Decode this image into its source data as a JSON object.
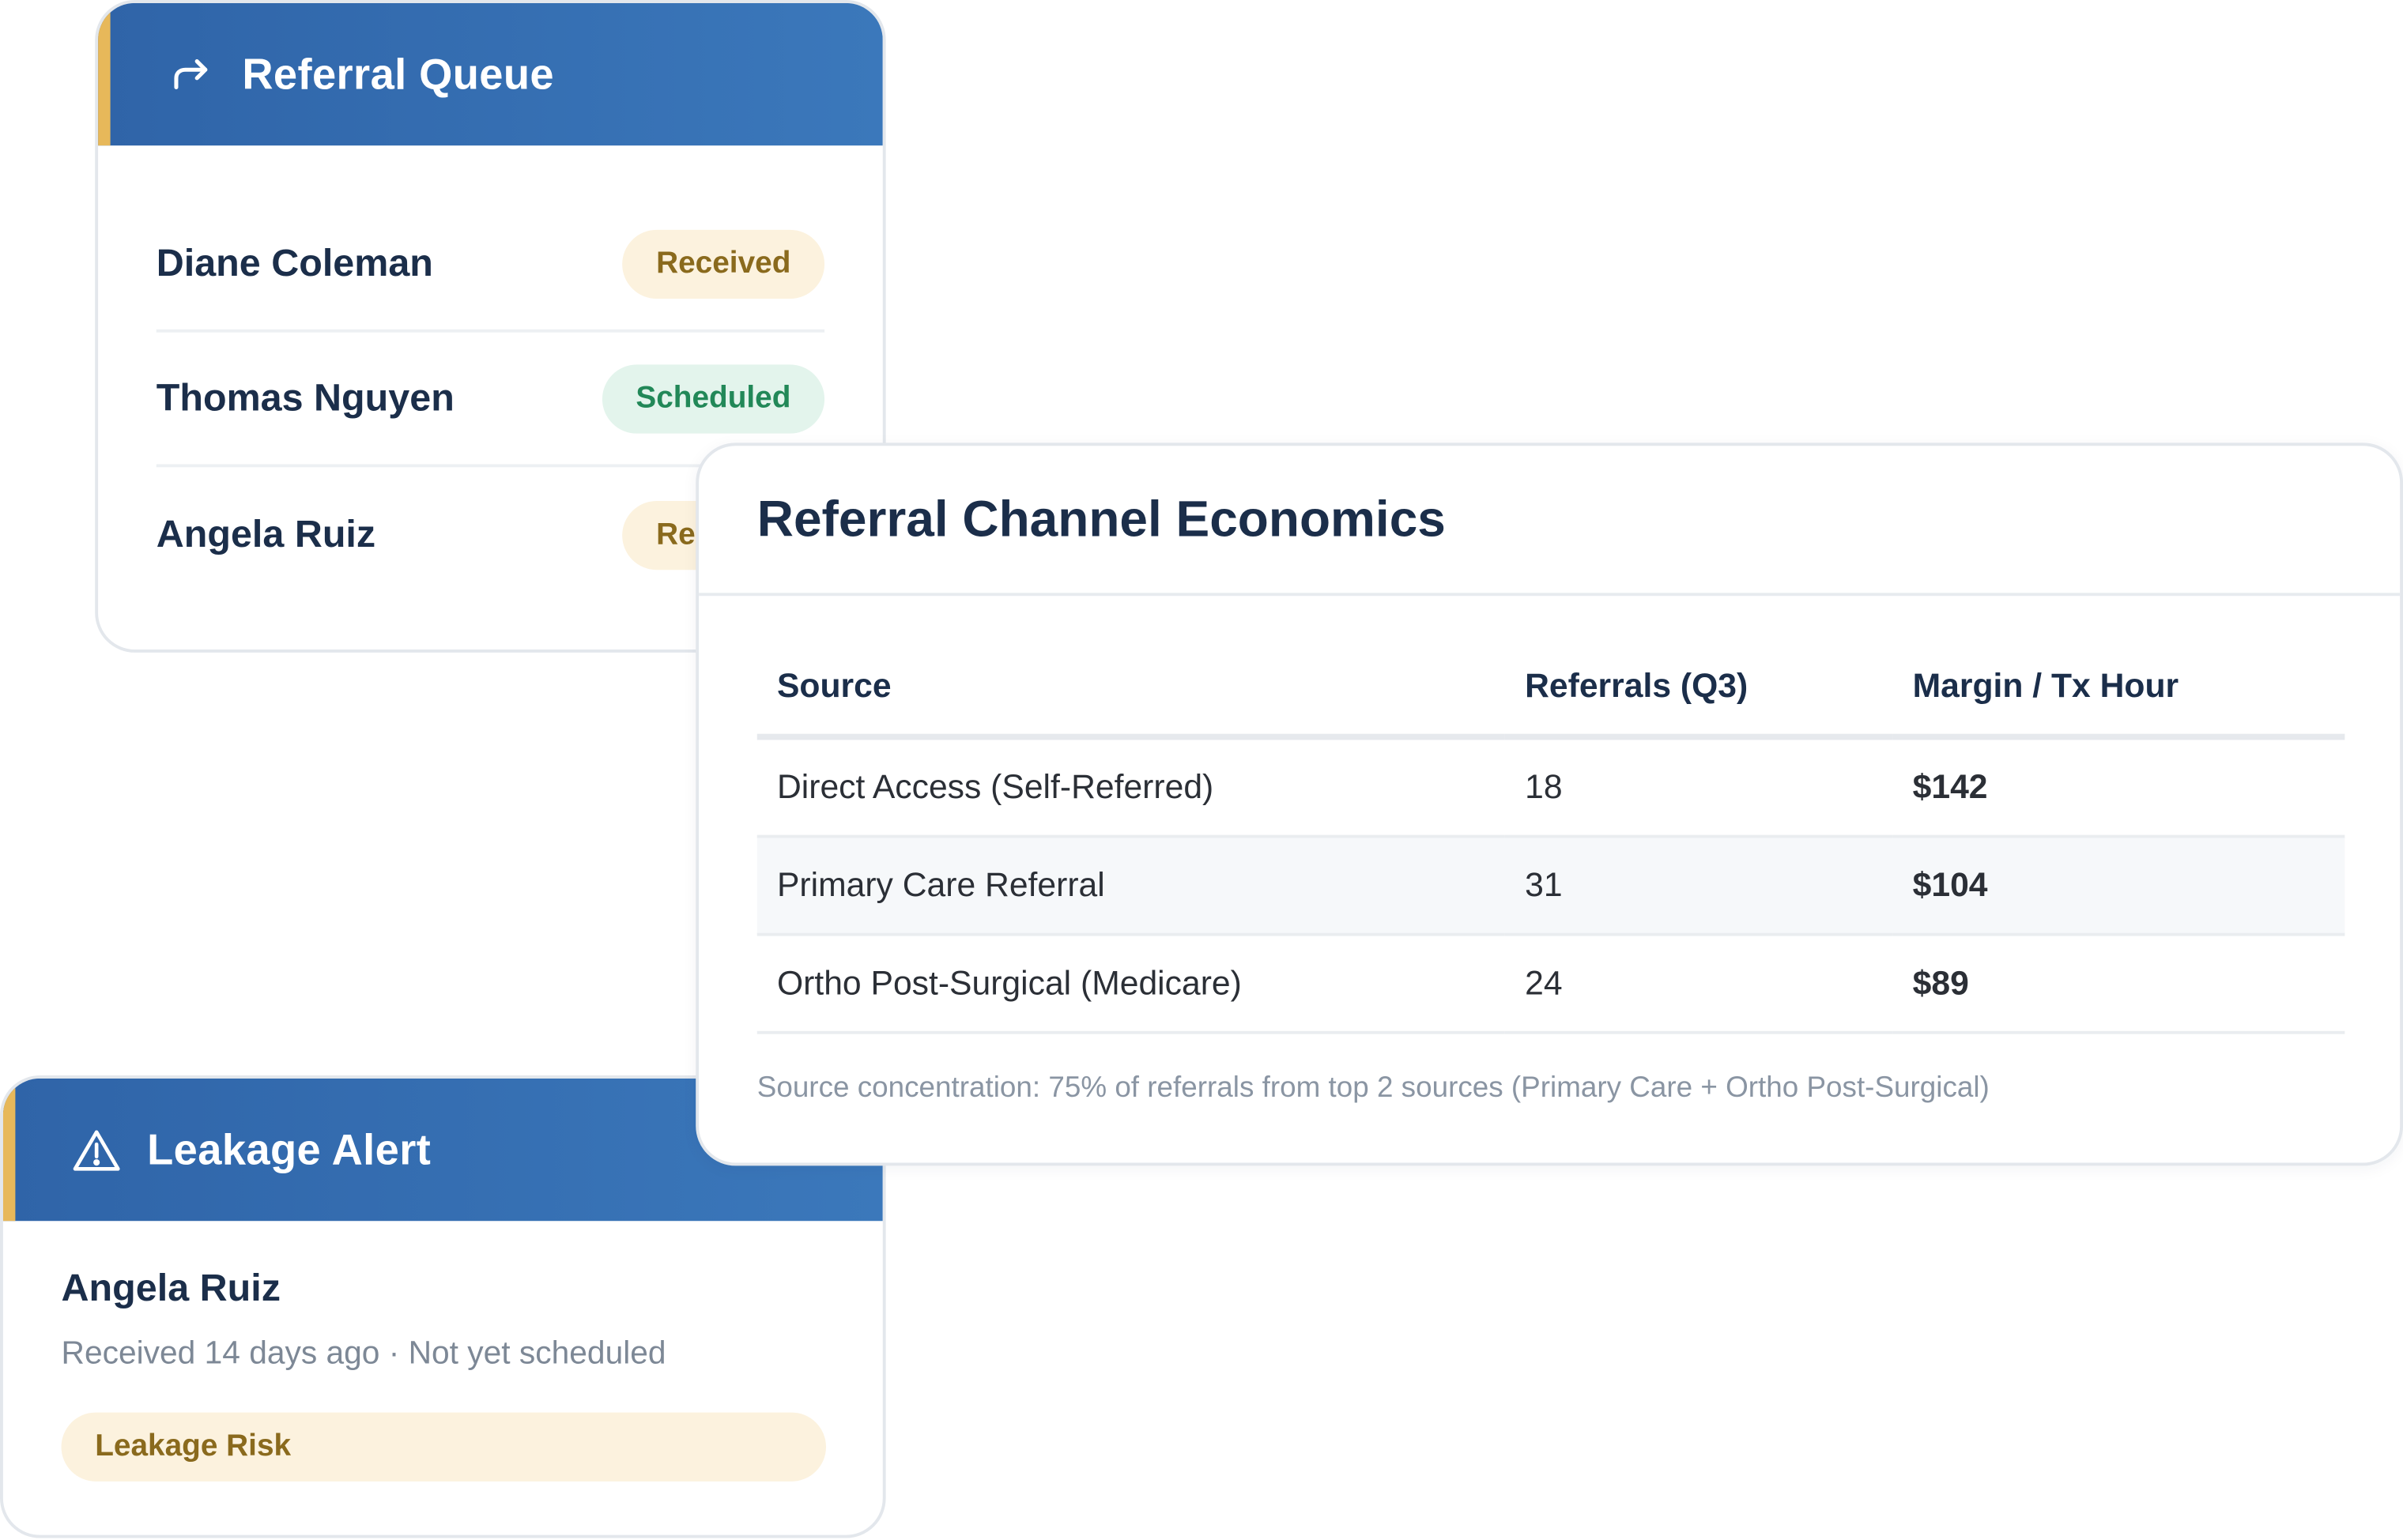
{
  "colors": {
    "header_blue": "#2f64a8",
    "accent_gold": "#e7b85a",
    "text_navy": "#1b2e4a",
    "status_received_bg": "#fcf2de",
    "status_received_fg": "#8a6a1d",
    "status_scheduled_bg": "#e3f4ec",
    "status_scheduled_fg": "#228858",
    "margin_good": "#1f8a57",
    "margin_bad": "#c0392b",
    "muted_text": "#8a95a3"
  },
  "referral_queue": {
    "title": "Referral Queue",
    "icon": "forward-arrow-icon",
    "rows": [
      {
        "name": "Diane Coleman",
        "status": "Received"
      },
      {
        "name": "Thomas Nguyen",
        "status": "Scheduled"
      },
      {
        "name": "Angela Ruiz",
        "status": "Received"
      }
    ]
  },
  "channel_economics": {
    "title": "Referral Channel Economics",
    "columns": [
      "Source",
      "Referrals (Q3)",
      "Margin / Tx Hour"
    ],
    "rows": [
      {
        "source": "Direct Access (Self-Referred)",
        "referrals": "18",
        "margin": "$142",
        "tone": "good"
      },
      {
        "source": "Primary Care Referral",
        "referrals": "31",
        "margin": "$104",
        "tone": "neutral"
      },
      {
        "source": "Ortho Post-Surgical (Medicare)",
        "referrals": "24",
        "margin": "$89",
        "tone": "bad"
      }
    ],
    "footnote": "Source concentration: 75% of referrals from top 2 sources (Primary Care + Ortho Post-Surgical)"
  },
  "leakage_alert": {
    "title": "Leakage Alert",
    "icon": "warning-triangle-icon",
    "patient": "Angela Ruiz",
    "detail": "Received 14 days ago · Not yet scheduled",
    "risk_label": "Leakage Risk"
  }
}
